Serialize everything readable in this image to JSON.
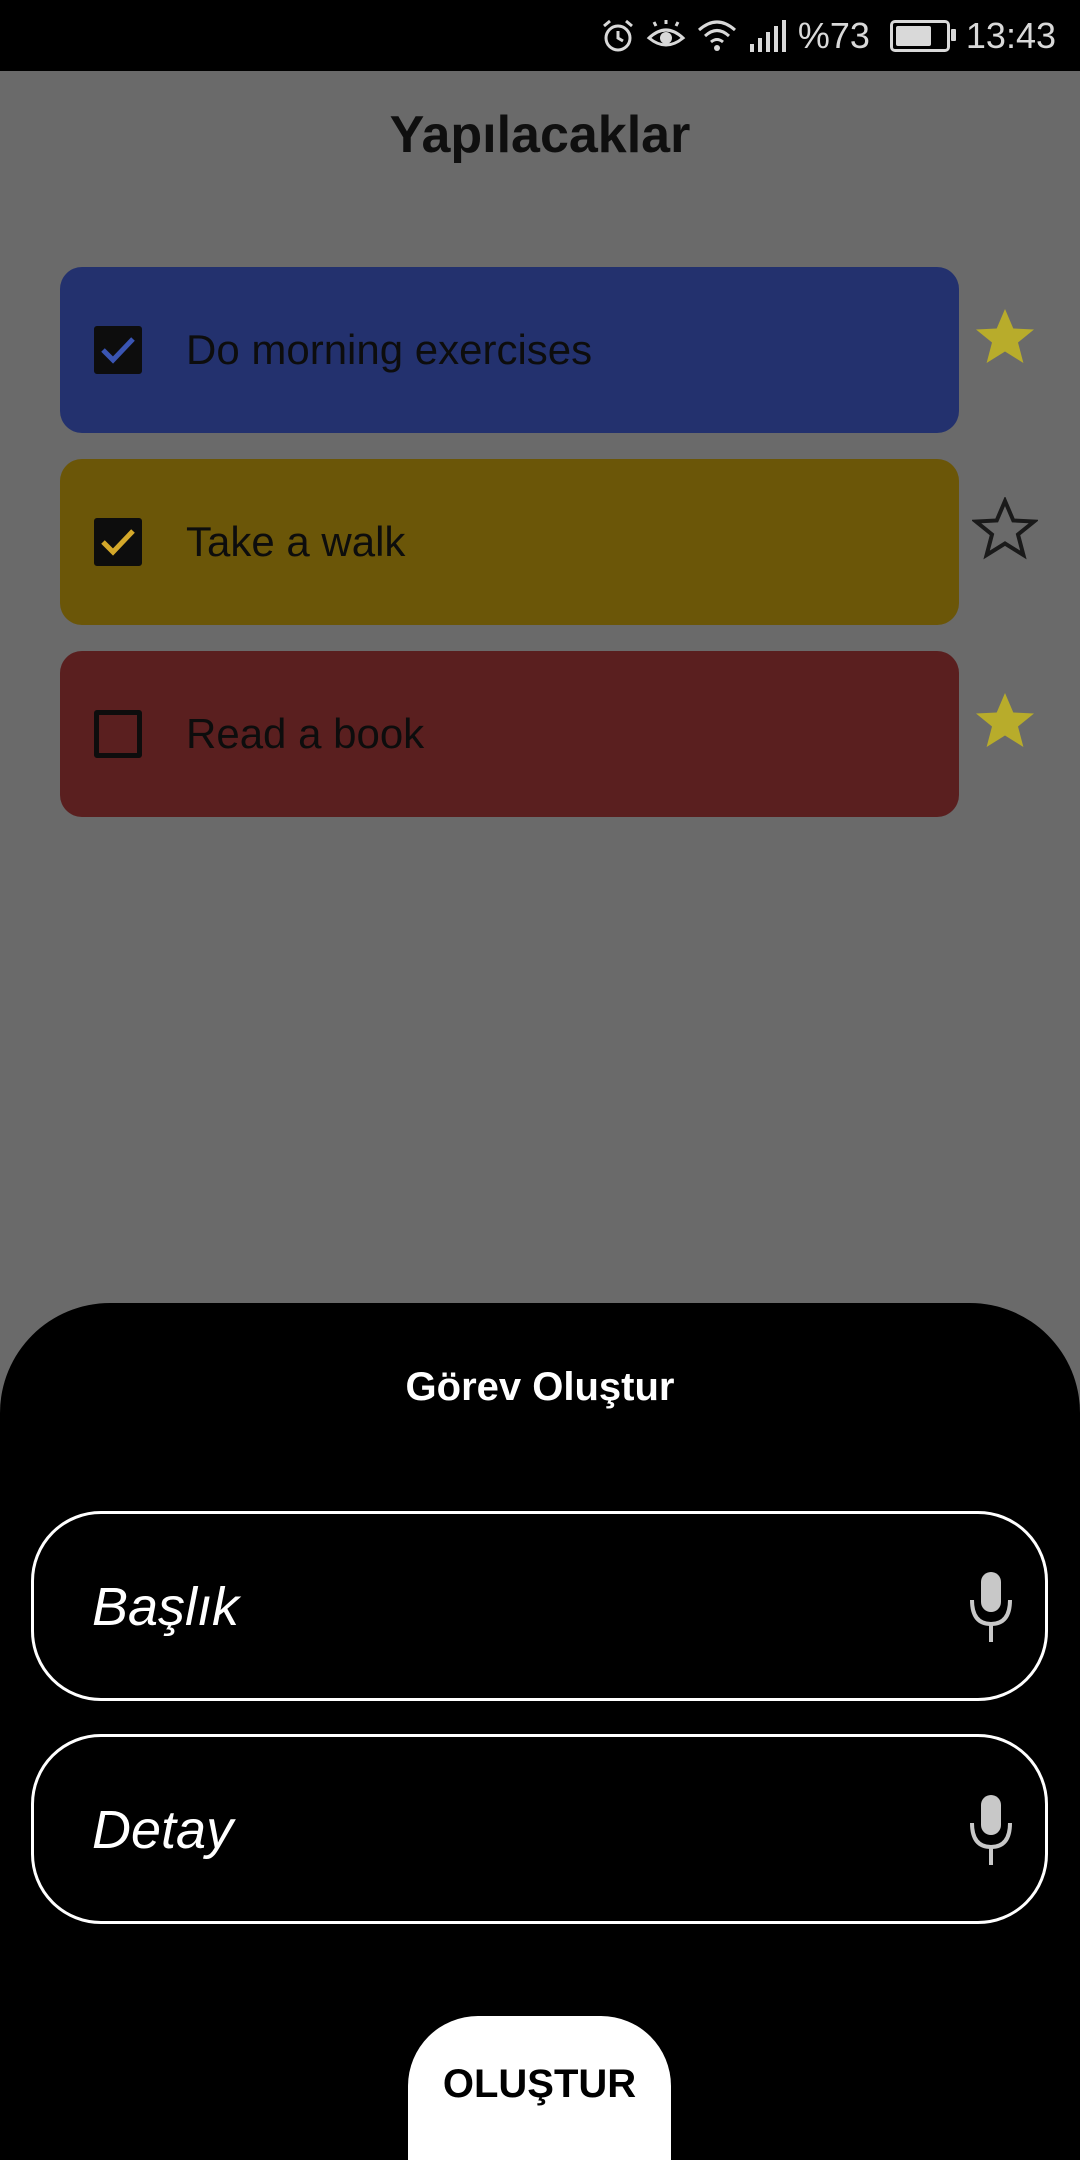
{
  "status_bar": {
    "icons": [
      "alarm-icon",
      "eye-comfort-icon",
      "wifi-icon",
      "signal-icon",
      "battery-icon"
    ],
    "battery_percent_text": "%73",
    "battery_level": 0.73,
    "time": "13:43"
  },
  "page": {
    "title": "Yapılacaklar"
  },
  "tasks": [
    {
      "label": "Do morning exercises",
      "checked": true,
      "starred": true,
      "color": "#23316e",
      "check_color": "#3a55b3"
    },
    {
      "label": "Take a walk",
      "checked": true,
      "starred": false,
      "color": "#6b5608",
      "check_color": "#d4a82a"
    },
    {
      "label": "Read a book",
      "checked": false,
      "starred": true,
      "color": "#5a1f1f",
      "check_color": "#000000"
    }
  ],
  "colors": {
    "background_dim": "#6a6a6a",
    "star_filled": "#b8ac2b",
    "star_outline": "#1a1a1a",
    "sheet": "#000000"
  },
  "sheet": {
    "title": "Görev Oluştur",
    "title_field": {
      "placeholder": "Başlık",
      "value": "",
      "icon": "mic-icon"
    },
    "detail_field": {
      "placeholder": "Detay",
      "value": "",
      "icon": "mic-icon"
    },
    "create_button": "OLUŞTUR"
  }
}
